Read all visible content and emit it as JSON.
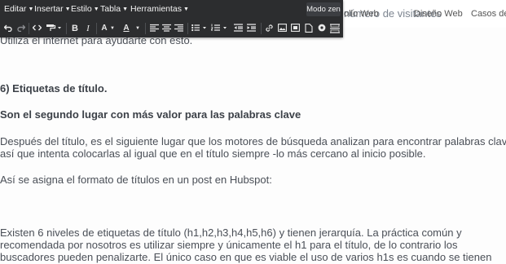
{
  "site": {
    "title_overlap": "número de visitantes",
    "nav_links": [
      "ollo Web",
      "Diseño Web",
      "Casos de"
    ]
  },
  "menubar": {
    "items": [
      "Editar",
      "Insertar",
      "Estilo",
      "Tabla",
      "Herramientas"
    ],
    "zen_label": "Modo zen"
  },
  "toolbar_icons": [
    "undo-icon",
    "redo-icon",
    "code-icon",
    "paint-format-icon",
    "bold-icon",
    "italic-icon",
    "font-color-icon",
    "background-color-icon",
    "align-left-icon",
    "align-center-icon",
    "align-right-icon",
    "bulleted-list-icon",
    "numbered-list-icon",
    "outdent-icon",
    "indent-icon",
    "link-icon",
    "image-icon",
    "video-icon",
    "file-icon",
    "cta-icon",
    "horizontal-rule-icon"
  ],
  "toolbar_text": {
    "bold": "B",
    "italic": "I",
    "font_color": "A",
    "bg_color": "A"
  },
  "content": {
    "l1": "Utiliza el internet para ayudarte con esto.",
    "h6": "6) Etiquetas de título.",
    "sub": "Son el segundo lugar con más valor para las palabras clave",
    "p1a": "Después del título, es el siguiente lugar que los motores de búsqueda analizan para encontrar palabras clave,",
    "p1b": "así que intenta colocarlas al igual que en el título siempre -lo más cercano al inicio posible.",
    "p2": "Así se asigna el formato de títulos en un post en Hubspot:",
    "p3a": "Existen 6 niveles de etiquetas de título (h1,h2,h3,h4,h5,h6) y tienen jerarquía. La práctica común y",
    "p3b": "recomendada por nosotros es utilizar siempre y únicamente el h1 para el título, de lo contrario los",
    "p3c": "buscadores pueden penalizarte. El único caso en que es viable el uso de varios h1s es cuando se tienen"
  }
}
